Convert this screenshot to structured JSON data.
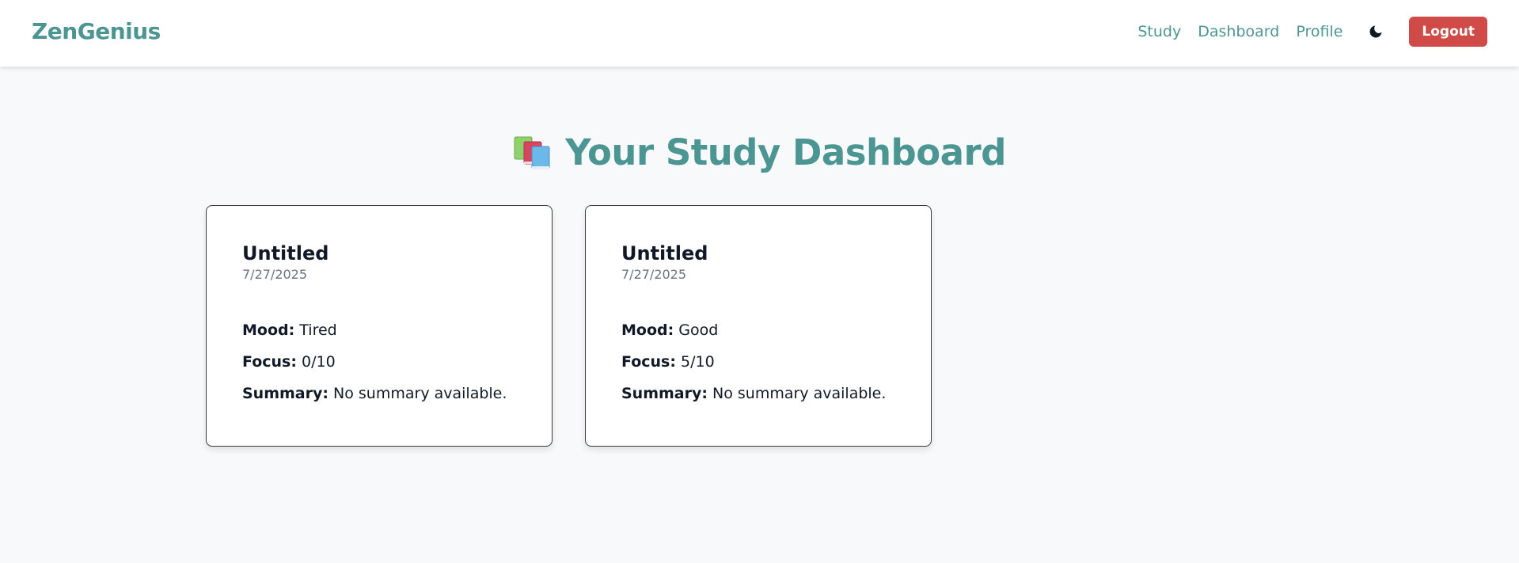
{
  "navbar": {
    "brand": "ZenGenius",
    "links": [
      {
        "label": "Study"
      },
      {
        "label": "Dashboard"
      },
      {
        "label": "Profile"
      }
    ],
    "theme_toggle_icon": "moon-icon",
    "logout_label": "Logout"
  },
  "page": {
    "heading_icon": "books-icon",
    "heading": "Your Study Dashboard"
  },
  "sessions": [
    {
      "title": "Untitled",
      "date": "7/27/2025",
      "mood_label": "Mood:",
      "mood": "Tired",
      "focus_label": "Focus:",
      "focus": "0/10",
      "summary_label": "Summary:",
      "summary": "No summary available."
    },
    {
      "title": "Untitled",
      "date": "7/27/2025",
      "mood_label": "Mood:",
      "mood": "Good",
      "focus_label": "Focus:",
      "focus": "5/10",
      "summary_label": "Summary:",
      "summary": "No summary available."
    }
  ],
  "colors": {
    "brand_teal": "#4b9593",
    "logout_red": "#d04a48",
    "page_background": "#f8f9fb"
  }
}
